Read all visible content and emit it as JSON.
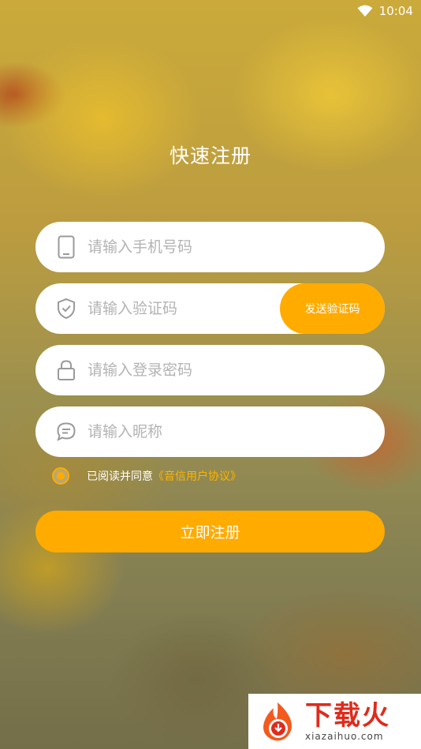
{
  "status_bar": {
    "time": "10:04",
    "wifi_icon": "wifi-icon"
  },
  "page": {
    "title": "快速注册"
  },
  "form": {
    "phone": {
      "icon": "phone-icon",
      "placeholder": "请输入手机号码"
    },
    "code": {
      "icon": "shield-check-icon",
      "placeholder": "请输入验证码",
      "send_label": "发送验证码"
    },
    "password": {
      "icon": "lock-icon",
      "placeholder": "请输入登录密码"
    },
    "nickname": {
      "icon": "chat-bubble-icon",
      "placeholder": "请输入昵称"
    }
  },
  "agreement": {
    "checked": true,
    "text": "已阅读并同意",
    "link": "《音信用户协议》"
  },
  "submit_label": "立即注册",
  "watermark": {
    "title": "下载火",
    "subtitle": "xiazaihuo.com"
  },
  "colors": {
    "accent": "#ffab00",
    "field_bg": "#ffffff",
    "placeholder": "#b3b3b3"
  }
}
